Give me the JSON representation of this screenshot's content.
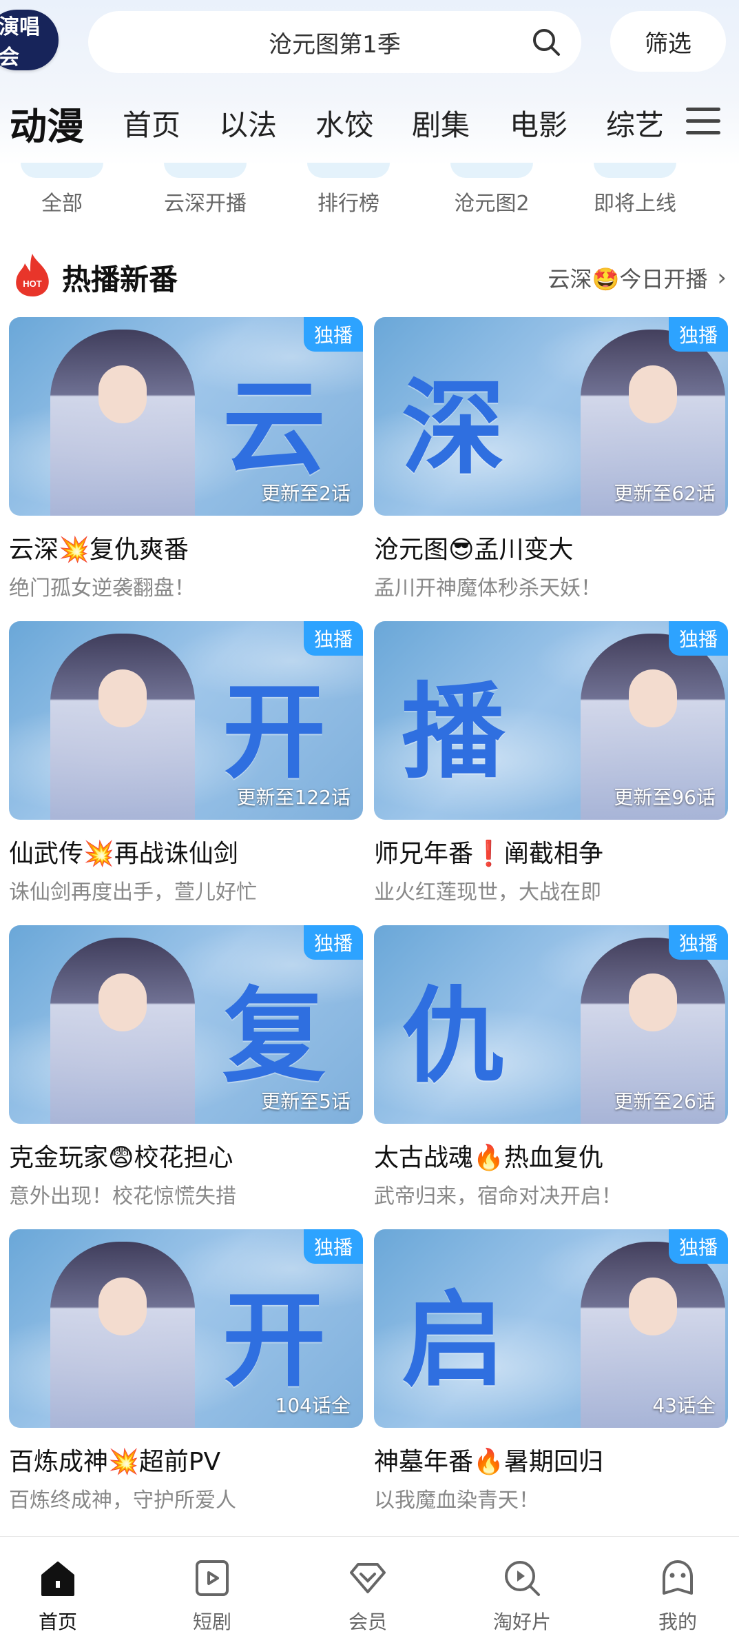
{
  "topbar": {
    "badge_text": "演唱会",
    "search_text": "沧元图第1季",
    "filter_label": "筛选"
  },
  "nav": {
    "items": [
      "动漫",
      "首页",
      "以法",
      "水饺",
      "剧集",
      "电影",
      "综艺"
    ],
    "active": "动漫"
  },
  "subtabs": [
    "全部",
    "云深开播",
    "排行榜",
    "沧元图2",
    "即将上线"
  ],
  "section": {
    "hot_badge": "HOT",
    "title": "热播新番",
    "more": "云深🤩今日开播"
  },
  "cards": [
    {
      "char": "云",
      "badge": "独播",
      "ep": "更新至2话",
      "title": "云深💥复仇爽番",
      "subtitle": "绝门孤女逆袭翻盘！"
    },
    {
      "char": "深",
      "badge": "独播",
      "ep": "更新至62话",
      "title": "沧元图😎孟川变大",
      "subtitle": "孟川开神魔体秒杀天妖！"
    },
    {
      "char": "开",
      "badge": "独播",
      "ep": "更新至122话",
      "title": "仙武传💥再战诛仙剑",
      "subtitle": "诛仙剑再度出手，萱儿好忙"
    },
    {
      "char": "播",
      "badge": "独播",
      "ep": "更新至96话",
      "title": "师兄年番❗阐截相争",
      "subtitle": "业火红莲现世，大战在即"
    },
    {
      "char": "复",
      "badge": "独播",
      "ep": "更新至5话",
      "title": "克金玩家😨校花担心",
      "subtitle": "意外出现！校花惊慌失措"
    },
    {
      "char": "仇",
      "badge": "独播",
      "ep": "更新至26话",
      "title": "太古战魂🔥热血复仇",
      "subtitle": "武帝归来，宿命对决开启！"
    },
    {
      "char": "开",
      "badge": "独播",
      "ep": "104话全",
      "title": "百炼成神💥超前PV",
      "subtitle": "百炼终成神，守护所爱人"
    },
    {
      "char": "启",
      "badge": "独播",
      "ep": "43话全",
      "title": "神墓年番🔥暑期回归",
      "subtitle": "以我魔血染青天！"
    }
  ],
  "bottom_tabs": [
    {
      "label": "首页",
      "icon": "home-icon",
      "active": true
    },
    {
      "label": "短剧",
      "icon": "short-drama-icon",
      "active": false
    },
    {
      "label": "会员",
      "icon": "vip-icon",
      "active": false
    },
    {
      "label": "淘好片",
      "icon": "discover-icon",
      "active": false
    },
    {
      "label": "我的",
      "icon": "profile-icon",
      "active": false
    }
  ],
  "colors": {
    "accent_blue": "#2da3ff",
    "title_char_blue": "#2f6fe0",
    "hot_red": "#e8352a"
  }
}
